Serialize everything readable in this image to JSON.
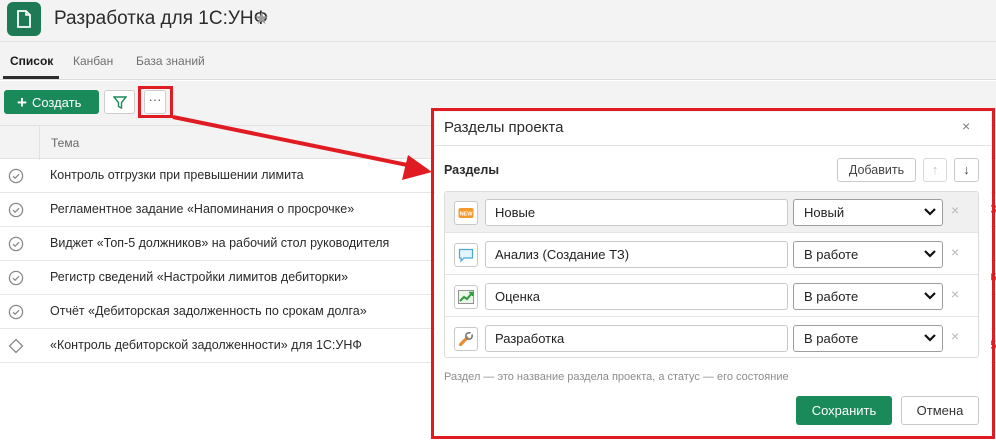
{
  "header": {
    "title": "Разработка для 1С:УНФ",
    "icon": "document-icon"
  },
  "tabs": [
    {
      "label": "Список",
      "active": true
    },
    {
      "label": "Канбан",
      "active": false
    },
    {
      "label": "База знаний",
      "active": false
    }
  ],
  "toolbar": {
    "create_label": "Создать",
    "more_label": "···"
  },
  "table": {
    "column": "Тема",
    "rows": [
      {
        "text": "Контроль отгрузки при превышении лимита",
        "status_icon": "check-circle-icon"
      },
      {
        "text": "Регламентное задание «Напоминания о просрочке»",
        "status_icon": "check-circle-icon",
        "edge": "3"
      },
      {
        "text": "Виджет «Топ-5 должников» на рабочий стол руководителя",
        "status_icon": "check-circle-icon"
      },
      {
        "text": "Регистр сведений «Настройки лимитов дебиторки»",
        "status_icon": "check-circle-icon",
        "edge": "6"
      },
      {
        "text": "Отчёт «Дебиторская задолженность по срокам долга»",
        "status_icon": "check-circle-icon"
      },
      {
        "text": "«Контроль дебиторской задолженности» для 1С:УНФ",
        "status_icon": "diamond-icon",
        "edge": "5"
      }
    ]
  },
  "modal": {
    "title": "Разделы проекта",
    "close": "×",
    "sections_label": "Разделы",
    "add_label": "Добавить",
    "up": "↑",
    "down": "↓",
    "rows": [
      {
        "name": "Новые",
        "status": "Новый",
        "icon": "new-badge-icon",
        "delete": "×"
      },
      {
        "name": "Анализ (Создание ТЗ)",
        "status": "В работе",
        "icon": "speech-bubble-icon",
        "delete": "×"
      },
      {
        "name": "Оценка",
        "status": "В работе",
        "icon": "chart-growth-icon",
        "delete": "×"
      },
      {
        "name": "Разработка",
        "status": "В работе",
        "icon": "wrench-icon",
        "delete": "×"
      }
    ],
    "hint": "Раздел — это название раздела проекта, а статус — его состояние",
    "save_label": "Сохранить",
    "cancel_label": "Отмена"
  },
  "colors": {
    "accent": "#1b8a5a",
    "highlight": "#e01b22"
  }
}
